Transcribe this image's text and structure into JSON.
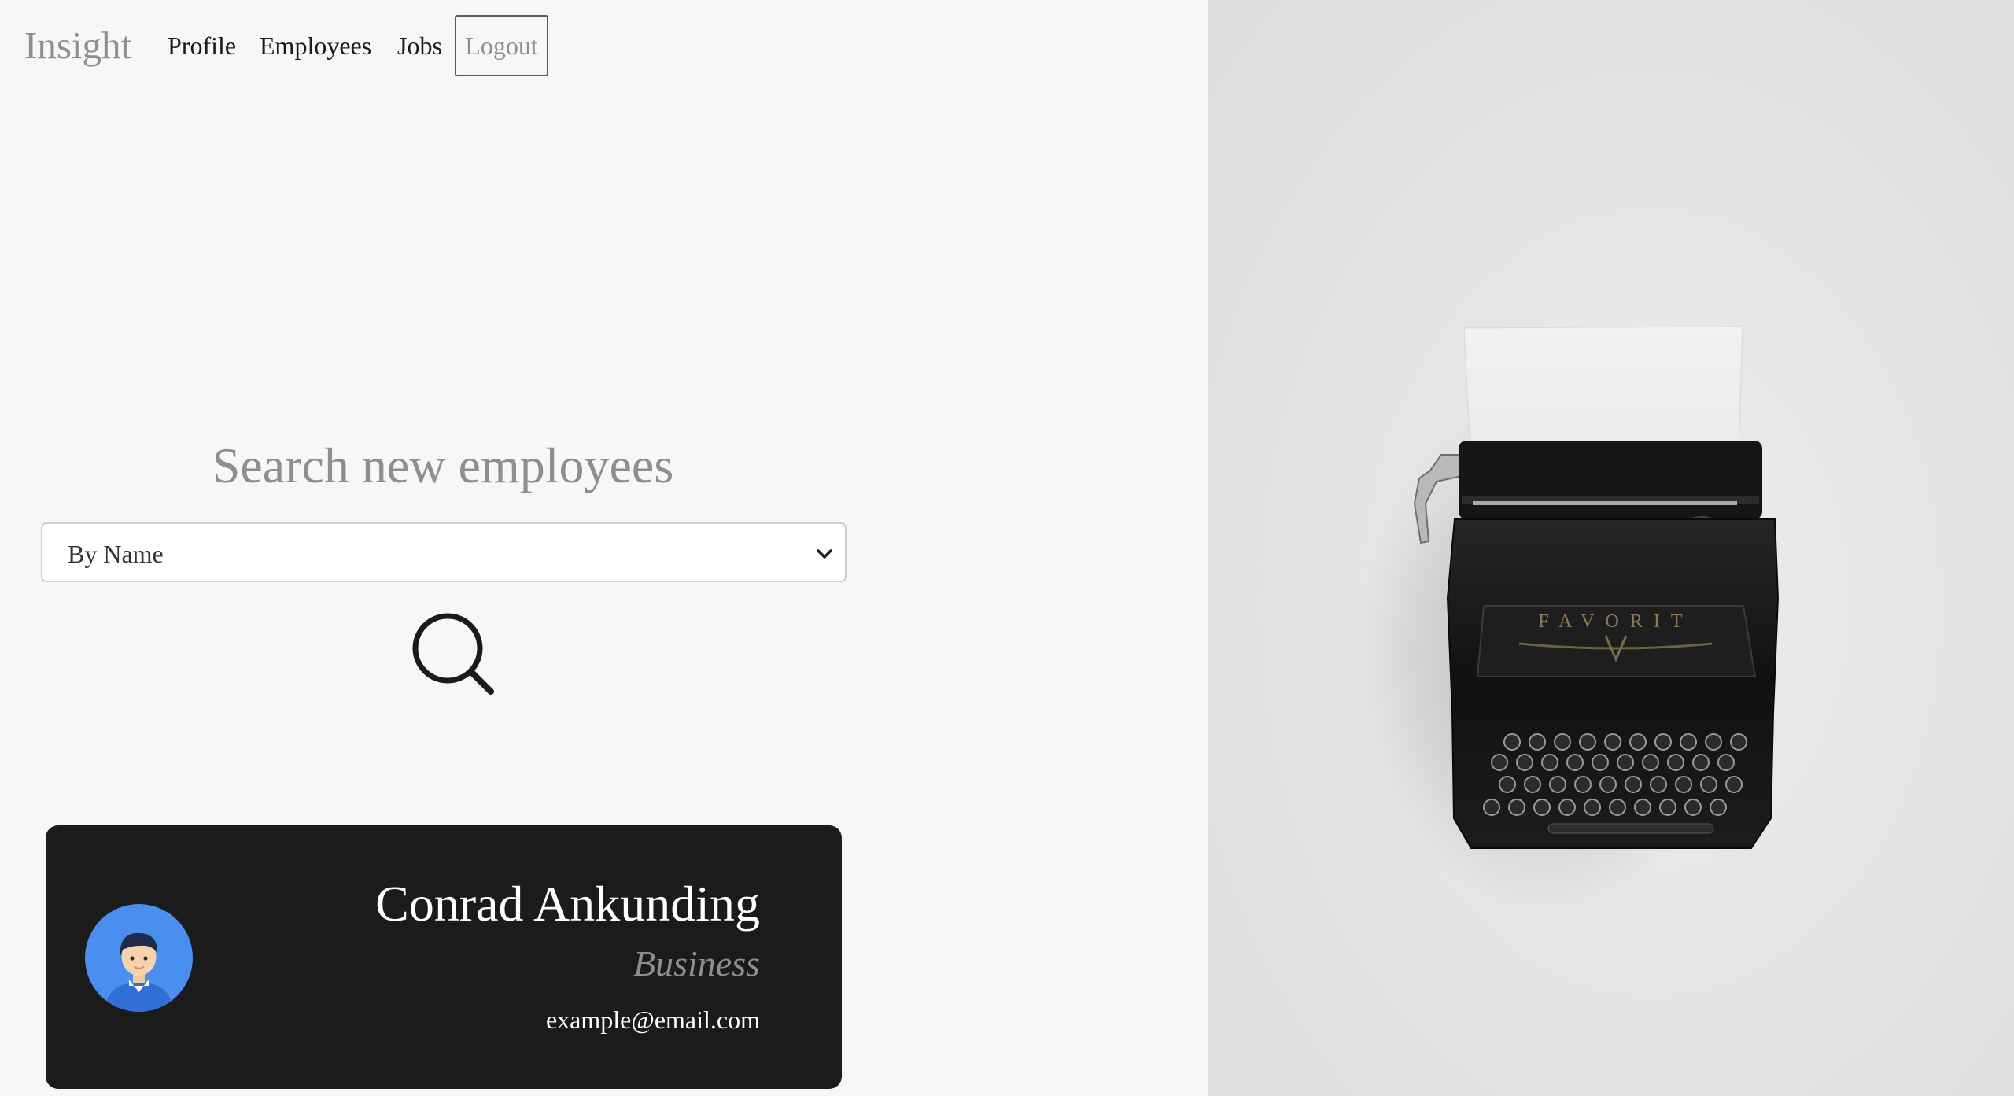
{
  "nav": {
    "brand": "Insight",
    "links": [
      {
        "label": "Profile"
      },
      {
        "label": "Employees"
      },
      {
        "label": "Jobs"
      }
    ],
    "logout_label": "Logout"
  },
  "search": {
    "title": "Search new employees",
    "filter_selected": "By Name",
    "search_icon": "search-icon"
  },
  "employee_card": {
    "name": "Conrad Ankunding",
    "department": "Business",
    "email": "example@email.com",
    "avatar_icon": "person-avatar-icon"
  },
  "hero_image": {
    "subject": "typewriter",
    "brand_text": "FAVORIT"
  },
  "colors": {
    "background": "#f7f7f7",
    "card_background": "#1b1b1b",
    "muted_text": "#8e8e8e",
    "avatar_blue": "#4a8ef0"
  }
}
